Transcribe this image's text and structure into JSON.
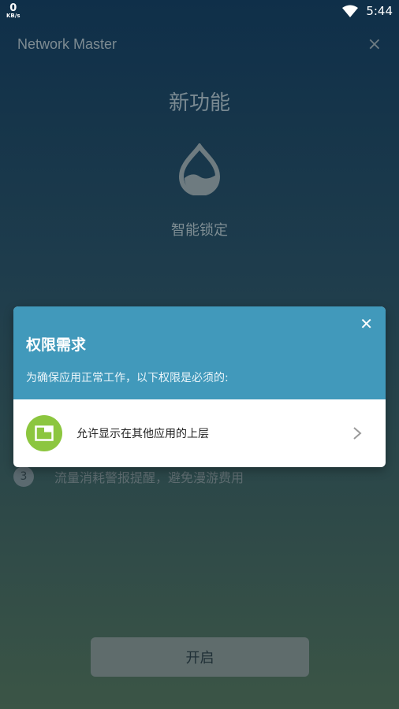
{
  "status_bar": {
    "net_speed_value": "0",
    "net_speed_unit": "KB/s",
    "time": "5:44",
    "icons": [
      "wifi-icon"
    ]
  },
  "header": {
    "app_title": "Network Master",
    "close_symbol": "×"
  },
  "feature": {
    "title": "新功能",
    "icon": "drop-icon",
    "name": "智能锁定"
  },
  "list": {
    "item3_number": "3",
    "item3_text": "流量消耗警报提醒，避免漫游费用"
  },
  "start_button": {
    "label": "开启"
  },
  "dialog": {
    "close_symbol": "✕",
    "title": "权限需求",
    "description": "为确保应用正常工作，以下权限是必须的:",
    "permission": {
      "label": "允许显示在其他应用的上层",
      "icon": "overlay-window-icon"
    }
  },
  "colors": {
    "dialog_header": "#4199bb",
    "permission_icon_bg": "#8cc63f",
    "background_top": "#0f2f49",
    "background_bottom": "#3b5546"
  }
}
